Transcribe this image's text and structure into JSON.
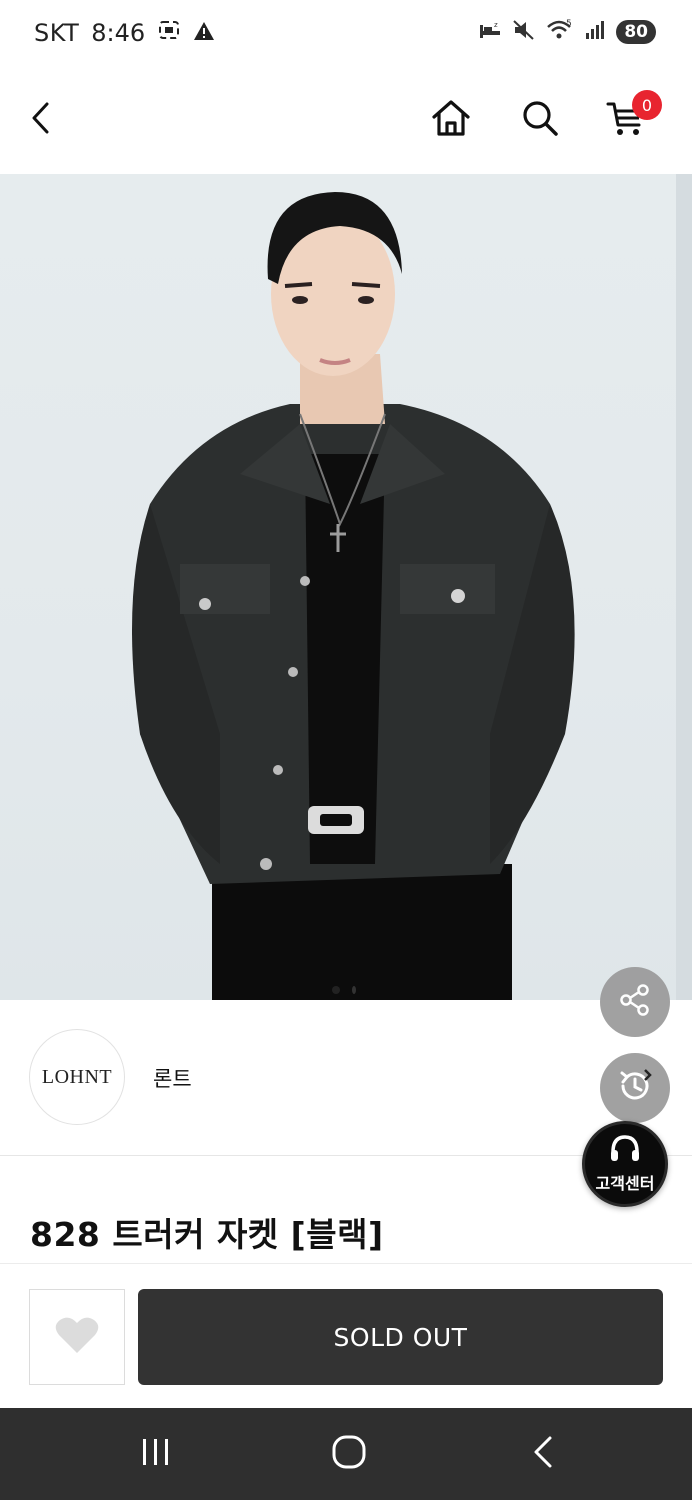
{
  "status_bar": {
    "carrier": "SKT",
    "time": "8:46",
    "battery": "80",
    "wifi_label": "5"
  },
  "header": {
    "cart_count": "0",
    "badge_color": "#e8242f"
  },
  "product": {
    "image_index": 1,
    "image_count": 2
  },
  "brand": {
    "logo_text": "LOHNT",
    "name": "론트"
  },
  "title": "828 트러커 자켓 [블랙]",
  "floating": {
    "customer_service_label": "고객센터"
  },
  "purchase": {
    "sold_out_label": "SOLD OUT",
    "button_color": "#333333"
  },
  "icons": {
    "back": "back-arrow-icon",
    "home": "home-icon",
    "search": "search-icon",
    "cart": "cart-icon",
    "share": "share-icon",
    "recent": "recent-history-icon",
    "headset": "headset-icon",
    "heart": "heart-icon"
  }
}
